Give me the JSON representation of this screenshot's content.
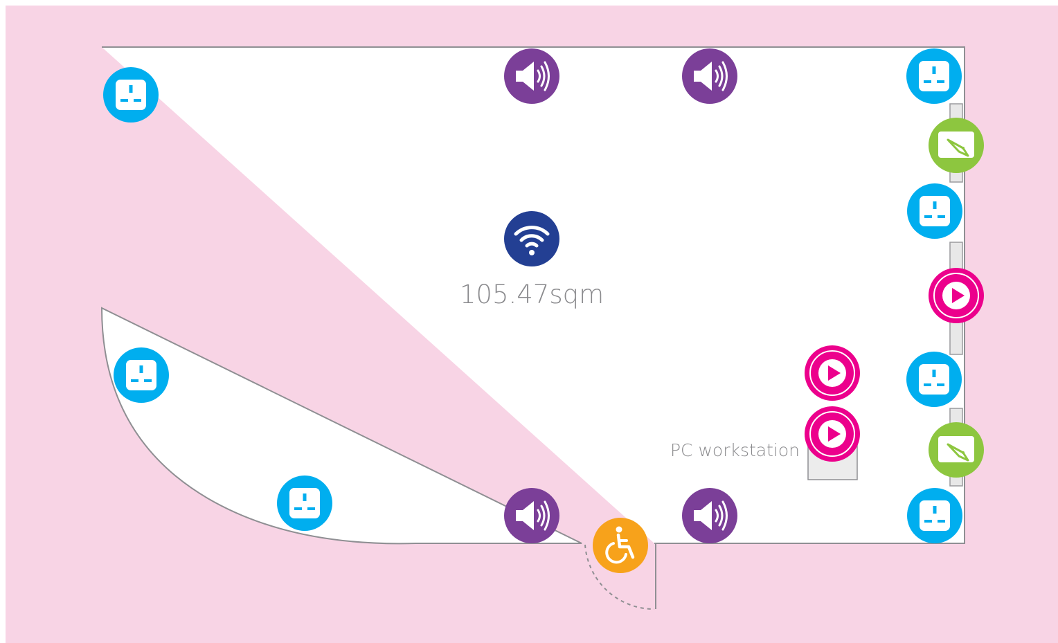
{
  "colors": {
    "background": "#f8d4e5",
    "room_fill": "#ffffff",
    "wall": "#8f8f93",
    "power": "#00aeef",
    "speaker": "#7b3f98",
    "screen": "#8dc63f",
    "media": "#ec008c",
    "wifi": "#233f93",
    "accessible": "#f7a21b"
  },
  "floor_plan": {
    "area": "105.47sqm",
    "workstation_label": "PC workstation"
  },
  "icons": {
    "wifi": "wifi-icon",
    "power": "power-socket-icon",
    "speaker": "speaker-icon",
    "screen": "projector-screen-icon",
    "media": "play-icon",
    "accessible": "wheelchair-icon"
  }
}
